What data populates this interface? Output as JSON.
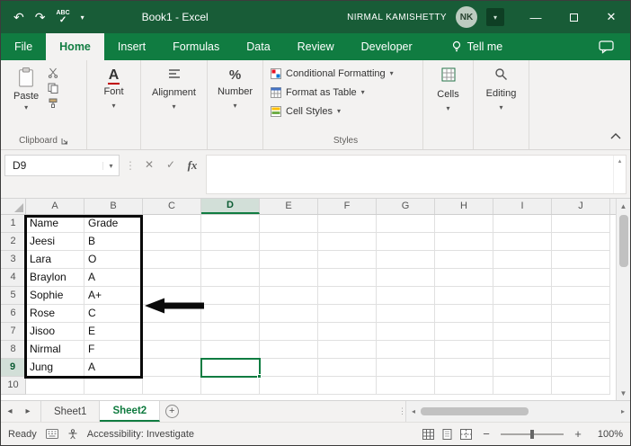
{
  "window": {
    "title": "Book1  -  Excel",
    "user_name": "NIRMAL KAMISHETTY",
    "user_initials": "NK"
  },
  "quick_access": {
    "spelling_label": "ABC"
  },
  "tabs": [
    {
      "label": "File",
      "active": false
    },
    {
      "label": "Home",
      "active": true
    },
    {
      "label": "Insert",
      "active": false
    },
    {
      "label": "Formulas",
      "active": false
    },
    {
      "label": "Data",
      "active": false
    },
    {
      "label": "Review",
      "active": false
    },
    {
      "label": "Developer",
      "active": false
    }
  ],
  "tell_me_label": "Tell me",
  "ribbon": {
    "paste": "Paste",
    "clipboard_group": "Clipboard",
    "font": "Font",
    "alignment": "Alignment",
    "number": "Number",
    "conditional_formatting": "Conditional Formatting",
    "format_as_table": "Format as Table",
    "cell_styles": "Cell Styles",
    "styles_group": "Styles",
    "cells": "Cells",
    "editing": "Editing"
  },
  "formula_bar": {
    "name_box": "D9",
    "fx_label": "fx",
    "value": ""
  },
  "grid": {
    "column_headers": [
      "A",
      "B",
      "C",
      "D",
      "E",
      "F",
      "G",
      "H",
      "I",
      "J"
    ],
    "row_numbers": [
      "1",
      "2",
      "3",
      "4",
      "5",
      "6",
      "7",
      "8",
      "9",
      "10"
    ],
    "selected_column": "D",
    "selected_row": 9,
    "active_cell": "D9",
    "rows": [
      [
        "Name",
        "Grade"
      ],
      [
        "Jeesi",
        "B"
      ],
      [
        "Lara",
        "O"
      ],
      [
        "Braylon",
        "A"
      ],
      [
        "Sophie",
        "A+"
      ],
      [
        "Rose",
        "C"
      ],
      [
        "Jisoo",
        "E"
      ],
      [
        "Nirmal",
        "F"
      ],
      [
        "Jung",
        "A"
      ],
      [
        "",
        ""
      ]
    ]
  },
  "sheets": {
    "tabs": [
      {
        "label": "Sheet1",
        "active": false
      },
      {
        "label": "Sheet2",
        "active": true
      }
    ]
  },
  "status_bar": {
    "mode": "Ready",
    "accessibility": "Accessibility: Investigate",
    "zoom_level": "100%"
  },
  "colors": {
    "titlebar_green": "#185c37",
    "ribbon_green": "#107c41",
    "selection_green": "#107c41",
    "range_border_black": "#0a0a0a"
  }
}
